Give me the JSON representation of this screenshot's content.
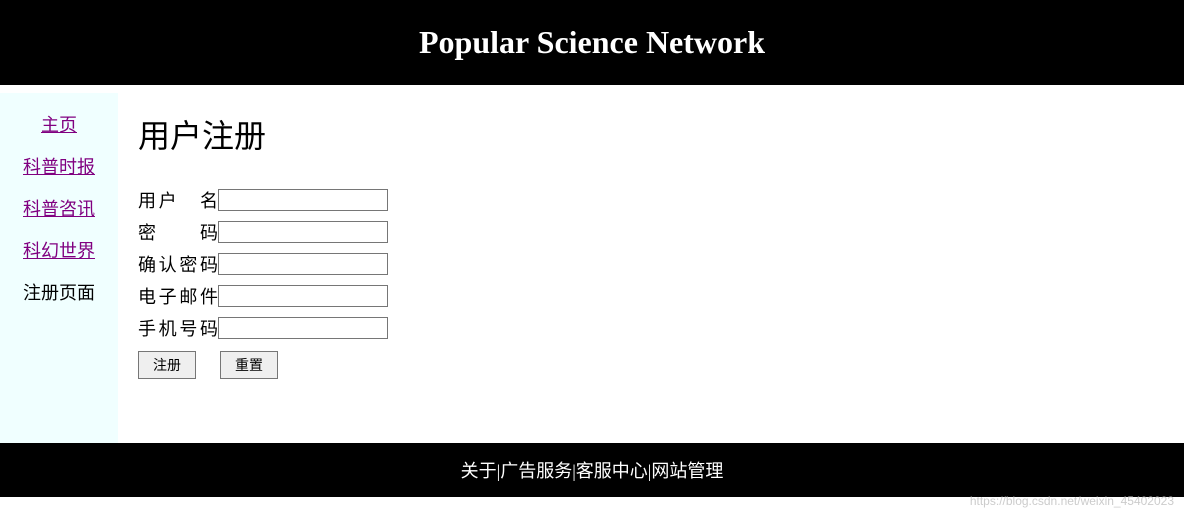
{
  "header": {
    "title": "Popular Science Network"
  },
  "sidebar": {
    "items": [
      {
        "label": "主页",
        "current": false
      },
      {
        "label": "科普时报",
        "current": false
      },
      {
        "label": "科普咨讯",
        "current": false
      },
      {
        "label": "科幻世界",
        "current": false
      },
      {
        "label": "注册页面",
        "current": true
      }
    ]
  },
  "main": {
    "title": "用户注册",
    "fields": {
      "username_label": "用户　名",
      "password_label": "密　　码",
      "confirm_label": "确认密码",
      "email_label": "电子邮件",
      "phone_label": "手机号码",
      "username_value": "",
      "password_value": "",
      "confirm_value": "",
      "email_value": "",
      "phone_value": ""
    },
    "buttons": {
      "register": "注册",
      "reset": "重置"
    }
  },
  "footer": {
    "text": "关于|广告服务|客服中心|网站管理"
  },
  "watermark": "https://blog.csdn.net/weixin_45402023"
}
